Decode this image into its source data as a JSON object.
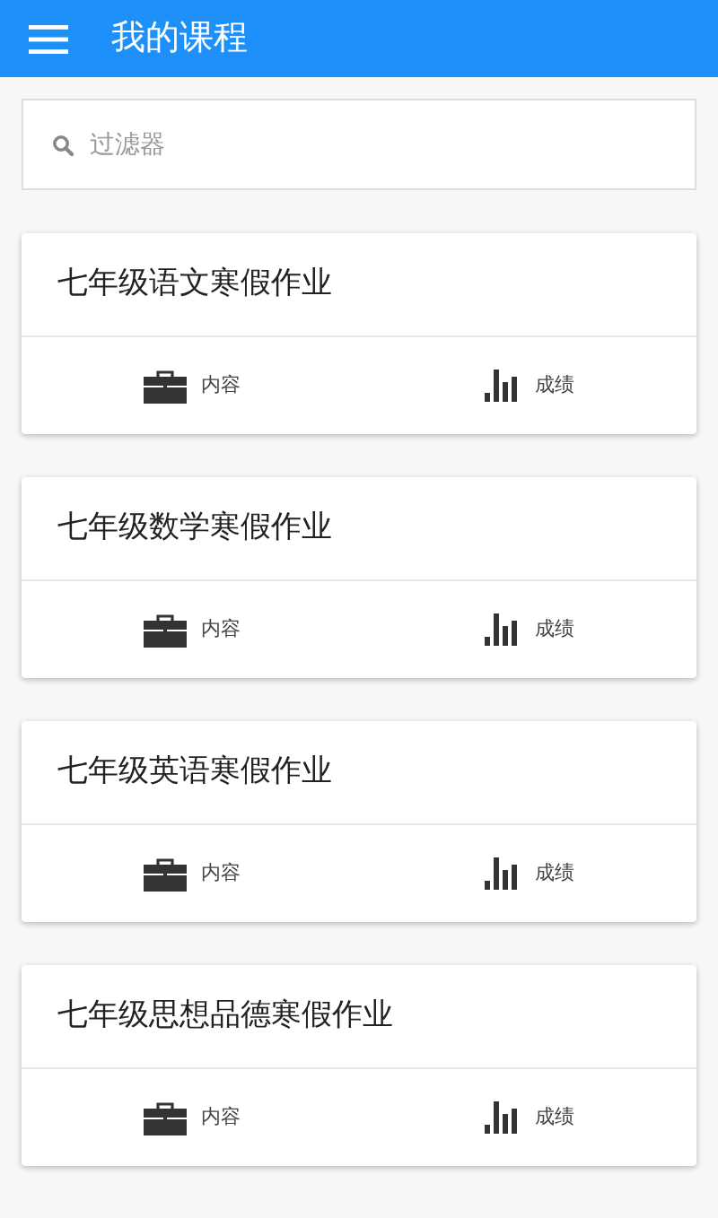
{
  "app_bar": {
    "title": "我的课程"
  },
  "filter": {
    "placeholder": "过滤器"
  },
  "courses": [
    {
      "title": "七年级语文寒假作业",
      "actions": [
        "内容",
        "成绩"
      ]
    },
    {
      "title": "七年级数学寒假作业",
      "actions": [
        "内容",
        "成绩"
      ]
    },
    {
      "title": "七年级英语寒假作业",
      "actions": [
        "内容",
        "成绩"
      ]
    },
    {
      "title": "七年级思想品德寒假作业",
      "actions": [
        "内容",
        "成绩"
      ]
    }
  ]
}
